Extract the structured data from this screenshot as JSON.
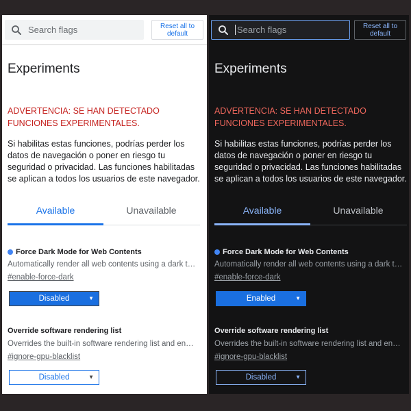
{
  "light": {
    "search_placeholder": "Search flags",
    "reset_line1": "Reset all to",
    "reset_line2": "default",
    "title": "Experiments",
    "warning": "ADVERTENCIA: SE HAN DETECTADO FUNCIONES EXPERIMENTALES.",
    "description": "Si habilitas estas funciones, podrías perder los datos de navegación o poner en riesgo tu seguridad o privacidad. Las funciones habilitadas se aplican a todos los usuarios de este navegador.",
    "tabs": [
      {
        "label": "Available"
      },
      {
        "label": "Unavailable"
      }
    ],
    "flags": [
      {
        "name": "Force Dark Mode for Web Contents",
        "description": "Automatically render all web contents using a dark t…",
        "link": "#enable-force-dark",
        "value": "Disabled"
      },
      {
        "name": "Override software rendering list",
        "description": "Overrides the built-in software rendering list and en…",
        "link": "#ignore-gpu-blacklist",
        "value": "Disabled"
      }
    ]
  },
  "dark": {
    "search_placeholder": "Search flags",
    "reset_line1": "Reset all to",
    "reset_line2": "default",
    "title": "Experiments",
    "warning": "ADVERTENCIA: SE HAN DETECTADO FUNCIONES EXPERIMENTALES.",
    "description": "Si habilitas estas funciones, podrías perder los datos de navegación o poner en riesgo tu seguridad o privacidad. Las funciones habilitadas se aplican a todos los usuarios de este navegador.",
    "tabs": [
      {
        "label": "Available"
      },
      {
        "label": "Unavailable"
      }
    ],
    "flags": [
      {
        "name": "Force Dark Mode for Web Contents",
        "description": "Automatically render all web contents using a dark t…",
        "link": "#enable-force-dark",
        "value": "Enabled"
      },
      {
        "name": "Override software rendering list",
        "description": "Overrides the built-in software rendering list and en…",
        "link": "#ignore-gpu-blacklist",
        "value": "Disabled"
      }
    ]
  },
  "icons": {
    "search": "search-icon",
    "dropdown": "chevron-down-icon",
    "modified_dot": "modified-indicator-icon"
  },
  "colors": {
    "accent_blue": "#1a73e8",
    "warning_red": "#c5221f",
    "dark_warning_red": "#ee675c",
    "select_fill": "#1a6fe0"
  }
}
